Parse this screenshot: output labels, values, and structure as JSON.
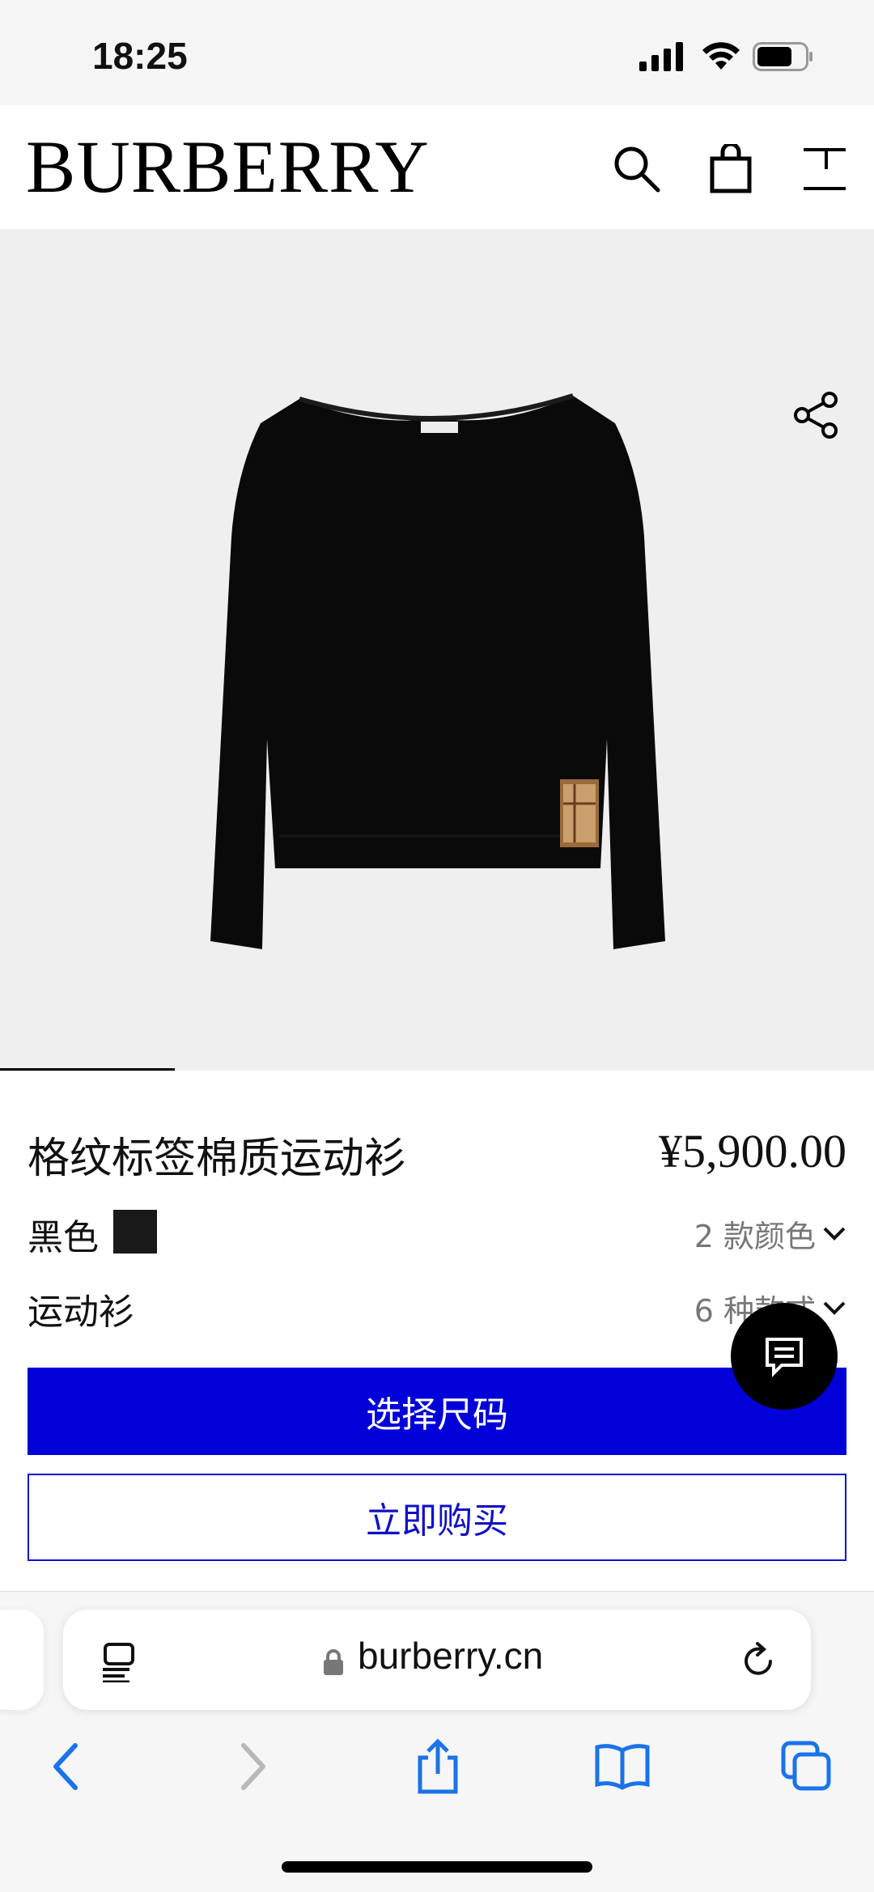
{
  "status_bar": {
    "time": "18:25"
  },
  "header": {
    "brand": "BURBERRY"
  },
  "product": {
    "title": "格纹标签棉质运动衫",
    "price": "¥5,900.00",
    "color_label": "黑色",
    "swatch_color": "#1a1a1a",
    "color_count": "2 款颜色",
    "style_label": "运动衫",
    "style_count": "6 种款式",
    "size_hint": "选择尺码",
    "gallery_position": 0.2
  },
  "actions": {
    "select_size": "选择尺码",
    "buy_now": "立即购买"
  },
  "browser": {
    "url": "burberry.cn"
  },
  "colors": {
    "accent_blue": "#0000d9",
    "buy_outline": "#1010c8"
  },
  "icons": {
    "search": "search-icon",
    "bag": "bag-icon",
    "menu": "menu-icon",
    "share": "share-icon",
    "chat": "chat-icon",
    "reader": "reader-icon",
    "lock": "lock-icon",
    "reload": "reload-icon",
    "back": "back-icon",
    "forward": "forward-icon",
    "share_sheet": "share-sheet-icon",
    "bookmarks": "bookmarks-icon",
    "tabs": "tabs-icon"
  }
}
